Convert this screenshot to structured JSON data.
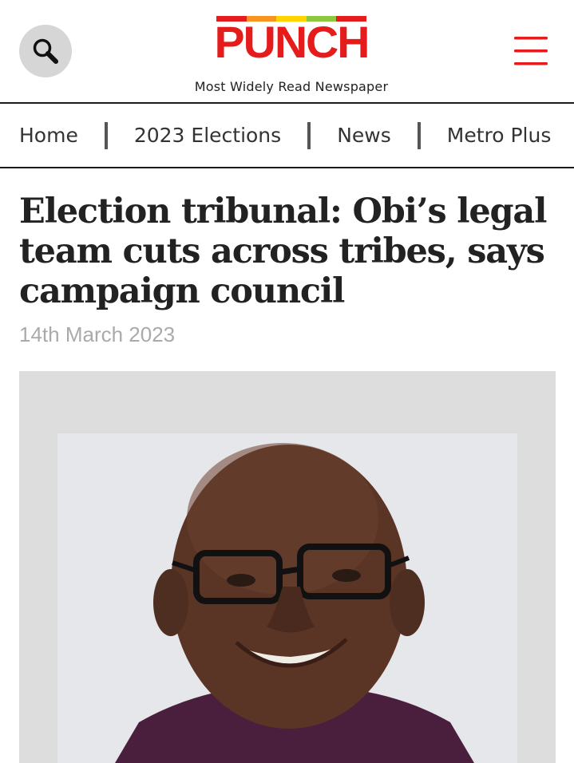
{
  "header": {
    "logo_text": "PUNCH",
    "tagline": "Most Widely Read Newspaper",
    "logo_bar_colors": [
      "#e41c1c",
      "#f7931e",
      "#ffd200",
      "#8dc63f",
      "#e41c1c"
    ],
    "search_icon": "search-icon",
    "menu_icon": "hamburger-menu-icon",
    "accent_color": "#e41c1c"
  },
  "nav": {
    "items": [
      {
        "label": "Home"
      },
      {
        "label": "2023 Elections"
      },
      {
        "label": "News"
      },
      {
        "label": "Metro Plus"
      }
    ]
  },
  "article": {
    "headline": "Election tribunal: Obi’s legal team cuts across tribes, says campaign council",
    "date": "14th March 2023",
    "image": "portrait-photo"
  }
}
